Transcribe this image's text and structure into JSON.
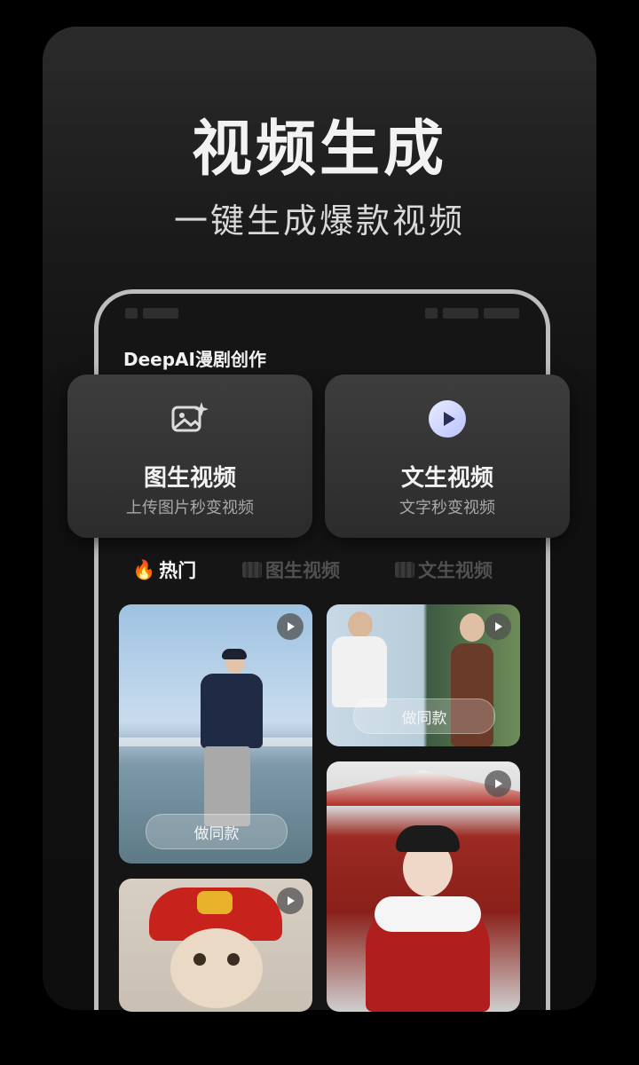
{
  "hero": {
    "title": "视频生成",
    "subtitle": "一键生成爆款视频"
  },
  "app": {
    "title": "DeepAI漫剧创作"
  },
  "features": [
    {
      "title": "图生视频",
      "subtitle": "上传图片秒变视频",
      "icon": "image-sparkle-icon"
    },
    {
      "title": "文生视频",
      "subtitle": "文字秒变视频",
      "icon": "play-circle-icon"
    }
  ],
  "tabs": [
    {
      "label": "热门",
      "icon": "flame-icon",
      "active": true
    },
    {
      "label": "图生视频",
      "icon": "clapper-icon",
      "active": false
    },
    {
      "label": "文生视频",
      "icon": "clapper-icon",
      "active": false
    }
  ],
  "gallery": {
    "same_style_label": "做同款"
  },
  "colors": {
    "background": "#000000",
    "card": "#1a1a1a",
    "feature_card": "#333333",
    "active_tab": "#f5f5f5",
    "inactive_tab": "#505050",
    "flame": "#ff8a1a"
  }
}
